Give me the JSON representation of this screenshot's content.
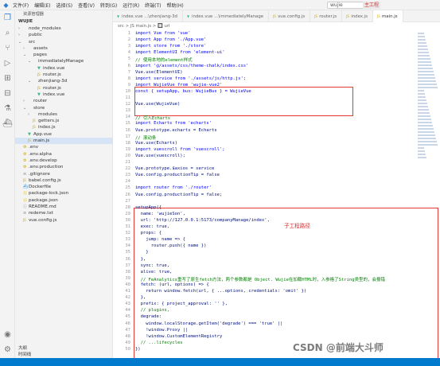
{
  "titlebar": {
    "menu": [
      "文件(F)",
      "编辑(E)",
      "选择(S)",
      "查看(V)",
      "转到(G)",
      "运行(R)",
      "终端(T)",
      "帮助(H)"
    ],
    "search": "wujie",
    "badge": "主工程"
  },
  "activity_icons": [
    "files-icon",
    "search-icon",
    "source-control-icon",
    "run-debug-icon",
    "extensions-icon",
    "remote-icon",
    "testing-icon",
    "docker-icon"
  ],
  "sidebar": {
    "title": "资源管理器",
    "project": "WUJIE",
    "tree": [
      {
        "label": "node_modules",
        "depth": 1,
        "folder": true,
        "open": false
      },
      {
        "label": "public",
        "depth": 1,
        "folder": true,
        "open": false
      },
      {
        "label": "src",
        "depth": 1,
        "folder": true,
        "open": true
      },
      {
        "label": "assets",
        "depth": 2,
        "folder": true,
        "open": false
      },
      {
        "label": "pages",
        "depth": 2,
        "folder": true,
        "open": true
      },
      {
        "label": "immediatelyManage",
        "depth": 3,
        "folder": true,
        "open": true
      },
      {
        "label": "index.vue",
        "depth": 4,
        "folder": false
      },
      {
        "label": "router.js",
        "depth": 4,
        "folder": false
      },
      {
        "label": "zhenjiang-3d",
        "depth": 3,
        "folder": true,
        "open": true
      },
      {
        "label": "router.js",
        "depth": 4,
        "folder": false
      },
      {
        "label": "index.vue",
        "depth": 4,
        "folder": false
      },
      {
        "label": "router",
        "depth": 2,
        "folder": true,
        "open": false
      },
      {
        "label": "store",
        "depth": 2,
        "folder": true,
        "open": true
      },
      {
        "label": "modules",
        "depth": 3,
        "folder": true,
        "open": false
      },
      {
        "label": "getters.js",
        "depth": 3,
        "folder": false
      },
      {
        "label": "index.js",
        "depth": 3,
        "folder": false
      },
      {
        "label": "App.vue",
        "depth": 2,
        "folder": false
      },
      {
        "label": "main.js",
        "depth": 2,
        "folder": false,
        "selected": true
      },
      {
        "label": ".env",
        "depth": 1,
        "folder": false
      },
      {
        "label": ".env.alpha",
        "depth": 1,
        "folder": false
      },
      {
        "label": ".env.develop",
        "depth": 1,
        "folder": false
      },
      {
        "label": ".env.production",
        "depth": 1,
        "folder": false
      },
      {
        "label": ".gitignore",
        "depth": 1,
        "folder": false
      },
      {
        "label": "babel.config.js",
        "depth": 1,
        "folder": false
      },
      {
        "label": "Dockerfile",
        "depth": 1,
        "folder": false
      },
      {
        "label": "package-lock.json",
        "depth": 1,
        "folder": false
      },
      {
        "label": "package.json",
        "depth": 1,
        "folder": false
      },
      {
        "label": "README.md",
        "depth": 1,
        "folder": false
      },
      {
        "label": "redeme.txt",
        "depth": 1,
        "folder": false
      },
      {
        "label": "vue.config.js",
        "depth": 1,
        "folder": false
      }
    ],
    "bottom": [
      "大纲",
      "时间线"
    ]
  },
  "tabs": [
    {
      "label": "index.vue ...\\zhenjiang-3d",
      "active": false
    },
    {
      "label": "index.vue ...\\immediatelyManage",
      "active": false
    },
    {
      "label": "vue.config.js",
      "active": false
    },
    {
      "label": "router.js",
      "active": false
    },
    {
      "label": "index.js",
      "active": false
    },
    {
      "label": "main.js",
      "active": true
    }
  ],
  "breadcrumb": "src > JS main.js > 🔲 url",
  "code": [
    {
      "n": "1",
      "t": "import Vue from 'vue'",
      "k": "kw"
    },
    {
      "n": "2",
      "t": "import App from './App.vue'",
      "k": "kw"
    },
    {
      "n": "3",
      "t": "import store from './store'",
      "k": "kw"
    },
    {
      "n": "4",
      "t": "import ElementUI from 'element-ui'",
      "k": "kw"
    },
    {
      "n": "5",
      "t": "// 使用本地的element样式",
      "k": "cm"
    },
    {
      "n": "6",
      "t": "import '@/assets/css/theme-chalk/index.css'",
      "k": "kw"
    },
    {
      "n": "7",
      "t": "Vue.use(ElementUI)",
      "k": "pl"
    },
    {
      "n": "8",
      "t": "import service from './assets/js/http.js';",
      "k": "kw"
    },
    {
      "n": "9",
      "t": "import WujieVue from 'wujie-vue2'",
      "k": "kw"
    },
    {
      "n": "10",
      "t": "const { setupApp, bus: WujieBus } = WujieVue",
      "k": "kw"
    },
    {
      "n": "11",
      "t": "",
      "k": "pl"
    },
    {
      "n": "12",
      "t": "Vue.use(WujieVue)",
      "k": "pl"
    },
    {
      "n": "13",
      "t": "",
      "k": "pl"
    },
    {
      "n": "14",
      "t": "// 引入Echarts",
      "k": "cm"
    },
    {
      "n": "15",
      "t": "import Echarts from 'echarts'",
      "k": "kw"
    },
    {
      "n": "16",
      "t": "Vue.prototype.echarts = Echarts",
      "k": "pl"
    },
    {
      "n": "17",
      "t": "// 滚动条",
      "k": "cm"
    },
    {
      "n": "18",
      "t": "Vue.use(Echarts)",
      "k": "pl"
    },
    {
      "n": "19",
      "t": "import vuescroll from 'vuescroll';",
      "k": "kw"
    },
    {
      "n": "20",
      "t": "Vue.use(vuescroll);",
      "k": "pl"
    },
    {
      "n": "21",
      "t": "",
      "k": "pl"
    },
    {
      "n": "22",
      "t": "Vue.prototype.$axios = service",
      "k": "pl"
    },
    {
      "n": "23",
      "t": "Vue.config.productionTip = false",
      "k": "pl"
    },
    {
      "n": "24",
      "t": "",
      "k": "pl"
    },
    {
      "n": "25",
      "t": "import router from './router'",
      "k": "kw"
    },
    {
      "n": "26",
      "t": "Vue.config.productionTip = false;",
      "k": "pl"
    },
    {
      "n": "27",
      "t": "",
      "k": "pl"
    },
    {
      "n": "28",
      "t": "setupApp({",
      "k": "pl"
    },
    {
      "n": "29",
      "t": "  name: 'wujieSon',",
      "k": "pl"
    },
    {
      "n": "30",
      "t": "  url: 'http://127.0.0.1:5173/companyManage/index',",
      "k": "pl"
    },
    {
      "n": "31",
      "t": "  exec: true,",
      "k": "pl"
    },
    {
      "n": "32",
      "t": "  props: {",
      "k": "pl"
    },
    {
      "n": "33",
      "t": "    jump: name => {",
      "k": "pl"
    },
    {
      "n": "34",
      "t": "      router.push({ name })",
      "k": "pl"
    },
    {
      "n": "35",
      "t": "    }",
      "k": "pl"
    },
    {
      "n": "36",
      "t": "  },",
      "k": "pl"
    },
    {
      "n": "37",
      "t": "  sync: true,",
      "k": "pl"
    },
    {
      "n": "38",
      "t": "  alive: true,",
      "k": "pl"
    },
    {
      "n": "39",
      "t": "  // FeAnalytics重写了原生fetch方法，两个参数都是 Object. Wujie在加载HTML时，入参格了String类型的，会报错",
      "k": "cm"
    },
    {
      "n": "40",
      "t": "  fetch: (url, options) => {",
      "k": "pl"
    },
    {
      "n": "41",
      "t": "    return window.fetch(url, { ...options, credentials: 'omit' })",
      "k": "pl"
    },
    {
      "n": "42",
      "t": "  },",
      "k": "pl"
    },
    {
      "n": "43",
      "t": "  prefix: { project_approval: '' },",
      "k": "pl"
    },
    {
      "n": "44",
      "t": "  // plugins,",
      "k": "cm"
    },
    {
      "n": "45",
      "t": "  degrade:",
      "k": "pl"
    },
    {
      "n": "46",
      "t": "    window.localStorage.getItem('degrade') === 'true' ||",
      "k": "pl"
    },
    {
      "n": "47",
      "t": "    !window.Proxy ||",
      "k": "pl"
    },
    {
      "n": "48",
      "t": "    !window.CustomElementRegistry",
      "k": "pl"
    },
    {
      "n": "49",
      "t": "  // ...lifecycles",
      "k": "cm"
    },
    {
      "n": "50",
      "t": "})",
      "k": "pl"
    }
  ],
  "annotation": "子工程路径",
  "watermark": "CSDN @前端大斗师"
}
